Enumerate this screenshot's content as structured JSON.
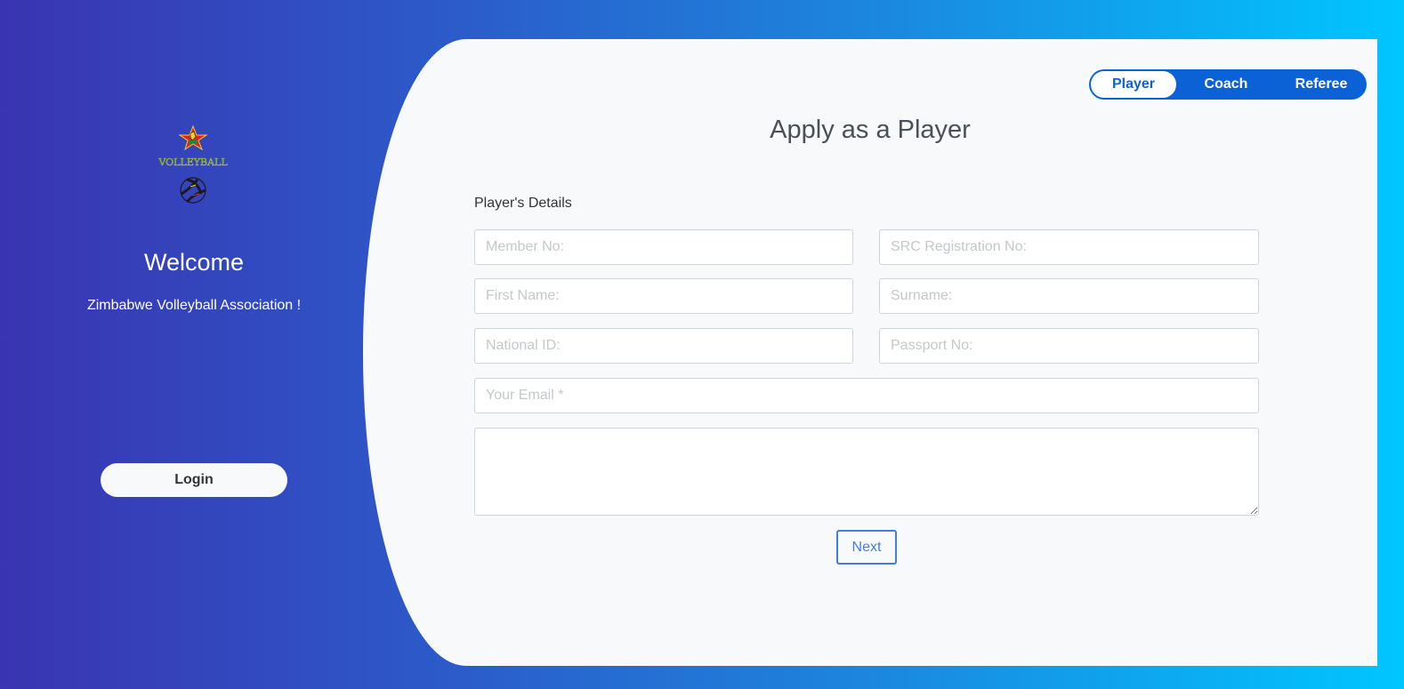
{
  "left_panel": {
    "logo_text": "VOLLEYBALL",
    "welcome_title": "Welcome",
    "welcome_subtitle": "Zimbabwe Volleyball Association !",
    "login_label": "Login"
  },
  "role_switch": {
    "tabs": [
      {
        "label": "Player",
        "active": true
      },
      {
        "label": "Coach",
        "active": false
      },
      {
        "label": "Referee",
        "active": false
      }
    ]
  },
  "form": {
    "title": "Apply as a Player",
    "section_label": "Player's Details",
    "fields": {
      "member_no": {
        "placeholder": "Member No:",
        "value": ""
      },
      "src_registration_no": {
        "placeholder": "SRC Registration No:",
        "value": ""
      },
      "first_name": {
        "placeholder": "First Name:",
        "value": ""
      },
      "surname": {
        "placeholder": "Surname:",
        "value": ""
      },
      "national_id": {
        "placeholder": "National ID:",
        "value": ""
      },
      "passport_no": {
        "placeholder": "Passport No:",
        "value": ""
      },
      "email": {
        "placeholder": "Your Email *",
        "value": ""
      },
      "message": {
        "placeholder": "",
        "value": ""
      }
    },
    "next_label": "Next"
  },
  "colors": {
    "accent_blue": "#0b62d6",
    "next_blue": "#3f7ee0",
    "card_bg": "#f8f9fb",
    "gradient_start": "#3a34b1",
    "gradient_end": "#00c6ff"
  }
}
